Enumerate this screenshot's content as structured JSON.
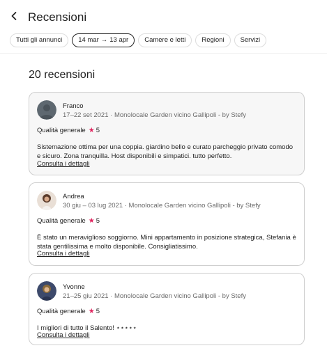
{
  "header": {
    "title": "Recensioni"
  },
  "filters": {
    "all_listings": "Tutti gli annunci",
    "date_from": "14 mar",
    "date_arrow": "→",
    "date_to": "13 apr",
    "rooms": "Camere e letti",
    "regions": "Regioni",
    "services": "Servizi"
  },
  "reviews_count": "20 recensioni",
  "reviews": [
    {
      "name": "Franco",
      "dates": "17–22 set 2021 · Monolocale Garden vicino Gallipoli - by Stefy",
      "rating_label": "Qualità generale",
      "rating_value": "5",
      "text": "Sistemazione ottima per una coppia. giardino bello e curato parcheggio privato comodo e sicuro. Zona tranquilla. Host disponibili e simpatici. tutto perfetto.",
      "link": "Consulta i dettagli"
    },
    {
      "name": "Andrea",
      "dates": "30 giu – 03 lug 2021 · Monolocale Garden vicino Gallipoli - by Stefy",
      "rating_label": "Qualità generale",
      "rating_value": "5",
      "text": "È stato un meraviglioso soggiorno. Mini appartamento in posizione strategica, Stefania è stata gentilissima e molto disponibile. Consigliatissimo.",
      "link": "Consulta i dettagli"
    },
    {
      "name": "Yvonne",
      "dates": "21–25 giu 2021 · Monolocale Garden vicino Gallipoli - by Stefy",
      "rating_label": "Qualità generale",
      "rating_value": "5",
      "text": "I migliori di tutto il Salento! ⋆⋆⋆⋆⋆",
      "link": "Consulta i dettagli"
    }
  ],
  "colors": {
    "star": "#e0245e",
    "text": "#222222",
    "muted": "#6a6a6a",
    "border": "#cfcfcf"
  },
  "icons": {
    "back": "chevron-left-icon",
    "star": "star-icon"
  }
}
